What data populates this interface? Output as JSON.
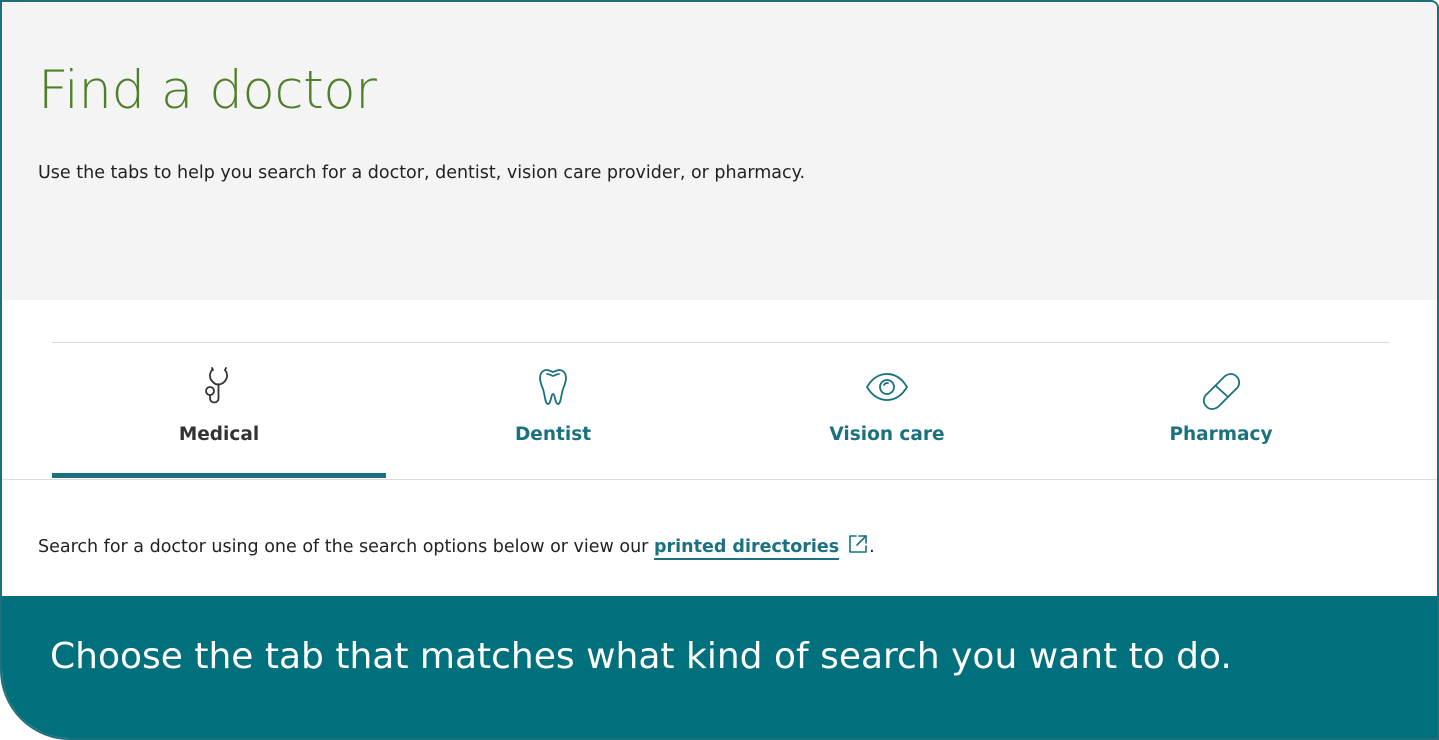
{
  "hero": {
    "title": "Find a doctor",
    "subtitle": "Use the tabs to help you search for a doctor, dentist, vision care provider, or pharmacy."
  },
  "tabs": [
    {
      "label": "Medical",
      "icon": "stethoscope-icon",
      "active": true
    },
    {
      "label": "Dentist",
      "icon": "tooth-icon",
      "active": false
    },
    {
      "label": "Vision care",
      "icon": "eye-icon",
      "active": false
    },
    {
      "label": "Pharmacy",
      "icon": "pill-icon",
      "active": false
    }
  ],
  "instruction": {
    "text": "Search for a doctor using one of the search options below or view our",
    "link_label": "printed directories",
    "link_icon": "external-link-icon",
    "suffix": "."
  },
  "banner": {
    "text": "Choose the tab that matches what kind of search you want to do."
  },
  "colors": {
    "title_green": "#4f7f2b",
    "teal": "#1b7180",
    "banner_teal": "#00707c",
    "hero_bg": "#f4f4f4"
  }
}
